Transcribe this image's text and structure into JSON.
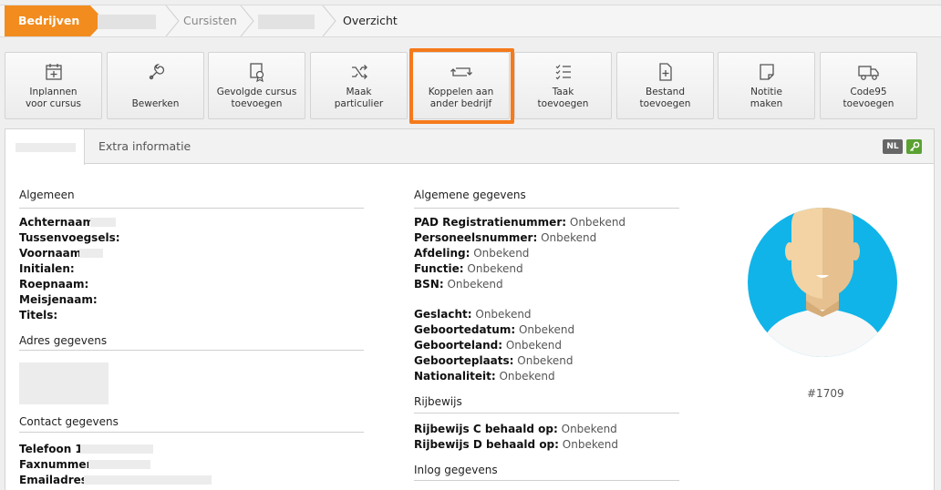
{
  "breadcrumb": {
    "items": [
      {
        "label": "Bedrijven"
      },
      {
        "label": ""
      },
      {
        "label": "Cursisten"
      },
      {
        "label": ""
      },
      {
        "label": "Overzicht"
      }
    ]
  },
  "toolbar": {
    "buttons": [
      {
        "label": "Inplannen\nvoor cursus",
        "icon": "calendar-plus-icon"
      },
      {
        "label": "Bewerken",
        "icon": "wrench-icon"
      },
      {
        "label": "Gevolgde cursus\ntoevoegen",
        "icon": "certificate-icon"
      },
      {
        "label": "Maak\nparticulier",
        "icon": "shuffle-icon"
      },
      {
        "label": "Koppelen aan\nander bedrijf",
        "icon": "retweet-icon"
      },
      {
        "label": "Taak\ntoevoegen",
        "icon": "task-list-icon"
      },
      {
        "label": "Bestand\ntoevoegen",
        "icon": "file-plus-icon"
      },
      {
        "label": "Notitie\nmaken",
        "icon": "note-icon"
      },
      {
        "label": "Code95\ntoevoegen",
        "icon": "truck-icon"
      }
    ],
    "highlight_color": "#f57a1a"
  },
  "tabs": {
    "first": "",
    "second": "Extra informatie",
    "lang_badge": "NL"
  },
  "left": {
    "algemeen_title": "Algemeen",
    "algemeen": [
      {
        "label": "Achternaam:",
        "value": ""
      },
      {
        "label": "Tussenvoegsels:",
        "value": ""
      },
      {
        "label": "Voornaam:",
        "value": ""
      },
      {
        "label": "Initialen:",
        "value": ""
      },
      {
        "label": "Roepnaam:",
        "value": ""
      },
      {
        "label": "Meisjenaam:",
        "value": ""
      },
      {
        "label": "Titels:",
        "value": ""
      }
    ],
    "adres_title": "Adres gegevens",
    "contact_title": "Contact gegevens",
    "contact": [
      {
        "label": "Telefoon 1:",
        "value": ""
      },
      {
        "label": "Faxnummer:",
        "value": ""
      },
      {
        "label": "Emailadres:",
        "value": ""
      }
    ]
  },
  "middle": {
    "algemene_title": "Algemene gegevens",
    "algemene": [
      {
        "label": "PAD Registratienummer:",
        "value": "Onbekend"
      },
      {
        "label": "Personeelsnummer:",
        "value": "Onbekend"
      },
      {
        "label": "Afdeling:",
        "value": "Onbekend"
      },
      {
        "label": "Functie:",
        "value": "Onbekend"
      },
      {
        "label": "BSN:",
        "value": "Onbekend"
      }
    ],
    "persoon": [
      {
        "label": "Geslacht:",
        "value": "Onbekend"
      },
      {
        "label": "Geboortedatum:",
        "value": "Onbekend"
      },
      {
        "label": "Geboorteland:",
        "value": "Onbekend"
      },
      {
        "label": "Geboorteplaats:",
        "value": "Onbekend"
      },
      {
        "label": "Nationaliteit:",
        "value": "Onbekend"
      }
    ],
    "rijbewijs_title": "Rijbewijs",
    "rijbewijs": [
      {
        "label": "Rijbewijs C behaald op:",
        "value": "Onbekend"
      },
      {
        "label": "Rijbewijs D behaald op:",
        "value": "Onbekend"
      }
    ],
    "inlog_title": "Inlog gegevens"
  },
  "profile": {
    "id": "#1709",
    "avatar_bg": "#10b4e8"
  }
}
